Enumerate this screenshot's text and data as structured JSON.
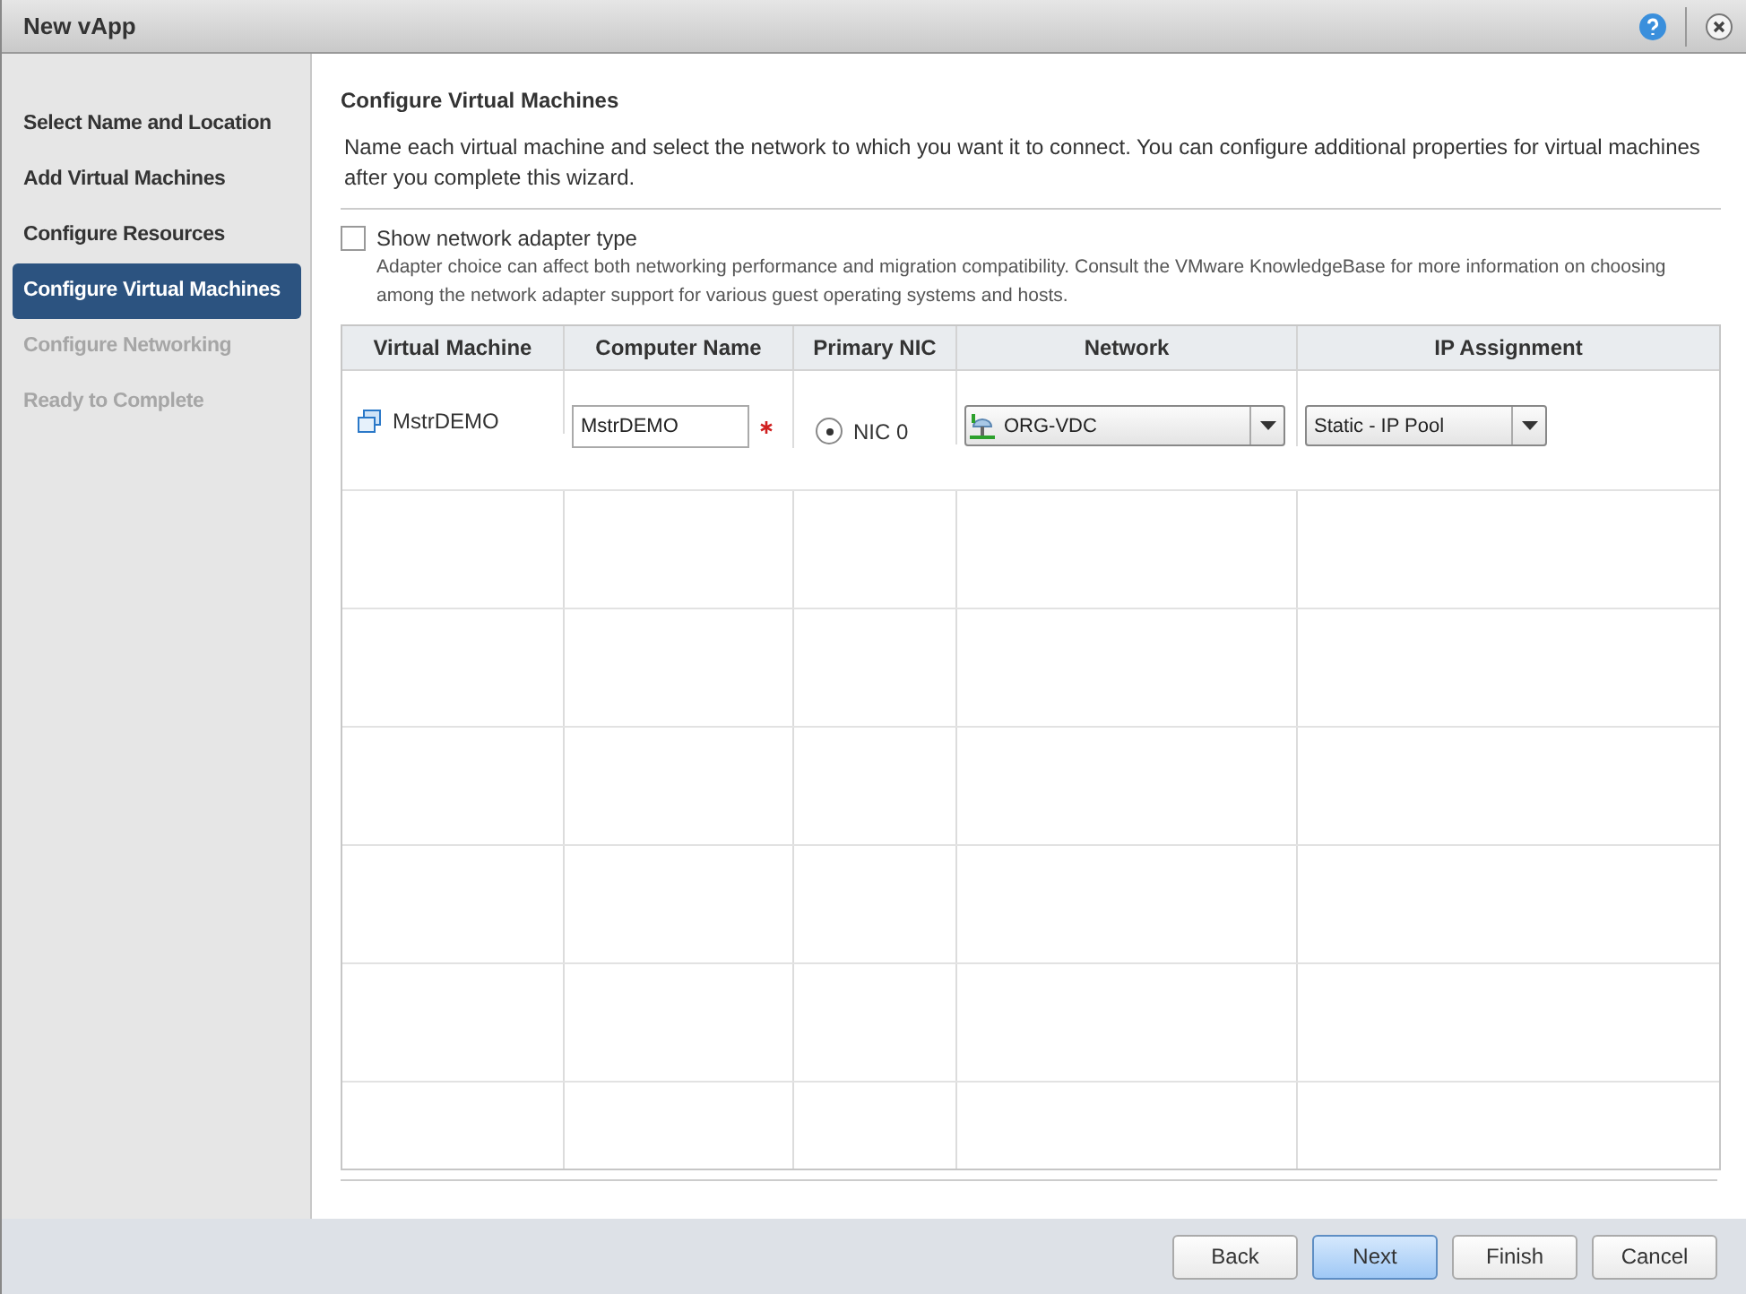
{
  "window": {
    "title": "New vApp"
  },
  "steps": [
    {
      "label": "Select Name and Location",
      "selected": false,
      "disabled": false
    },
    {
      "label": "Add Virtual Machines",
      "selected": false,
      "disabled": false
    },
    {
      "label": "Configure Resources",
      "selected": false,
      "disabled": false
    },
    {
      "label": "Configure Virtual Machines",
      "selected": true,
      "disabled": false
    },
    {
      "label": "Configure Networking",
      "selected": false,
      "disabled": true
    },
    {
      "label": "Ready to Complete",
      "selected": false,
      "disabled": true
    }
  ],
  "page": {
    "heading": "Configure Virtual Machines",
    "description": "Name each virtual machine and select the network to which you want it to connect. You can configure additional properties for virtual machines after you complete this wizard.",
    "adapter_option": {
      "label": "Show network adapter type",
      "checked": false,
      "note": "Adapter choice can affect both networking performance and migration compatibility. Consult the VMware KnowledgeBase for more information on choosing among the network adapter support for various guest operating systems and hosts."
    }
  },
  "table": {
    "columns": [
      "Virtual Machine",
      "Computer Name",
      "Primary NIC",
      "Network",
      "IP Assignment"
    ],
    "rows": [
      {
        "vm": "MstrDEMO",
        "computer_name": "MstrDEMO",
        "required": true,
        "nic": "NIC 0",
        "nic_selected": true,
        "network": "ORG-VDC",
        "ip_assignment": "Static - IP Pool"
      }
    ]
  },
  "buttons": [
    {
      "label": "Back",
      "primary": false
    },
    {
      "label": "Next",
      "primary": true
    },
    {
      "label": "Finish",
      "primary": false
    },
    {
      "label": "Cancel",
      "primary": false
    }
  ]
}
